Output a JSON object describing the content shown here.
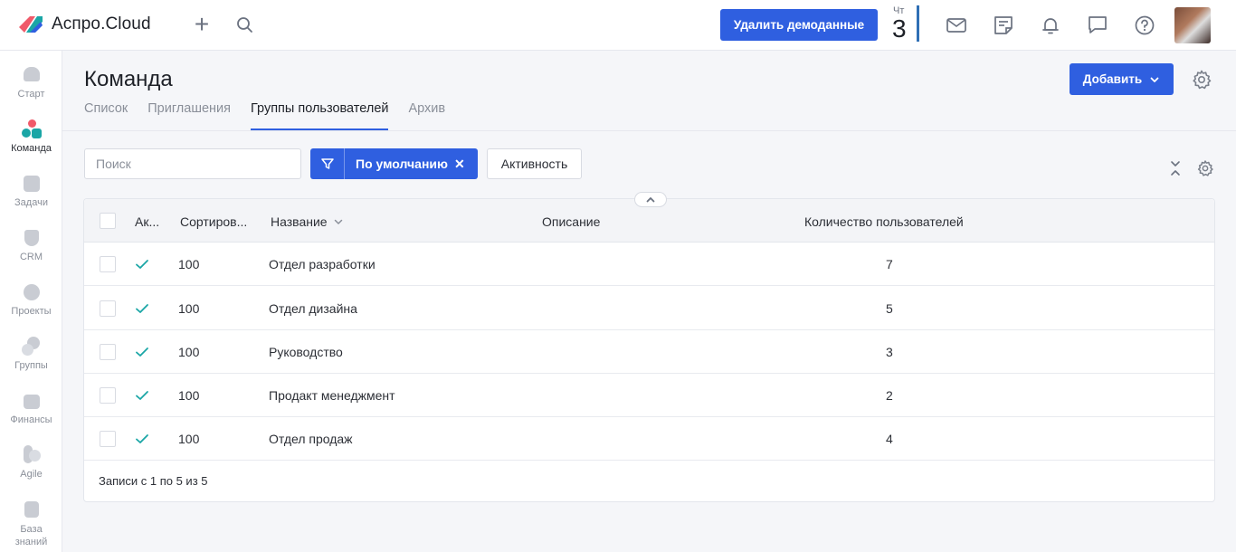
{
  "app": {
    "name": "Аспро.Cloud",
    "brand_color": "#2f5fe0"
  },
  "header": {
    "demo_button": "Удалить демоданные",
    "date_day": "Чт",
    "date_number": "3",
    "icons": [
      "plus-icon",
      "search-icon",
      "mail-icon",
      "notes-icon",
      "bell-icon",
      "chat-icon",
      "help-icon"
    ]
  },
  "sidebar": {
    "items": [
      {
        "label": "Старт",
        "icon": "heart-icon"
      },
      {
        "label": "Команда",
        "icon": "team-icon"
      },
      {
        "label": "Задачи",
        "icon": "tasks-icon"
      },
      {
        "label": "CRM",
        "icon": "crm-icon"
      },
      {
        "label": "Проекты",
        "icon": "projects-icon"
      },
      {
        "label": "Группы",
        "icon": "groups-icon"
      },
      {
        "label": "Финансы",
        "icon": "finance-icon"
      },
      {
        "label": "Agile",
        "icon": "agile-icon"
      },
      {
        "label": "База знаний",
        "icon": "knowledge-icon"
      }
    ],
    "active": "Команда"
  },
  "page": {
    "title": "Команда",
    "add_button": "Добавить",
    "tabs": [
      "Список",
      "Приглашения",
      "Группы пользователей",
      "Архив"
    ],
    "active_tab": "Группы пользователей"
  },
  "filters": {
    "search_placeholder": "Поиск",
    "preset_label": "По умолчанию",
    "activity_label": "Активность"
  },
  "table": {
    "columns": [
      "Ак...",
      "Сортиров...",
      "Название",
      "Описание",
      "Количество пользователей"
    ],
    "rows": [
      {
        "active": true,
        "sort": "100",
        "name": "Отдел разработки",
        "description": "",
        "count": "7"
      },
      {
        "active": true,
        "sort": "100",
        "name": "Отдел дизайна",
        "description": "",
        "count": "5"
      },
      {
        "active": true,
        "sort": "100",
        "name": "Руководство",
        "description": "",
        "count": "3"
      },
      {
        "active": true,
        "sort": "100",
        "name": "Продакт менеджмент",
        "description": "",
        "count": "2"
      },
      {
        "active": true,
        "sort": "100",
        "name": "Отдел продаж",
        "description": "",
        "count": "4"
      }
    ],
    "footer": "Записи с 1 по 5 из 5"
  }
}
